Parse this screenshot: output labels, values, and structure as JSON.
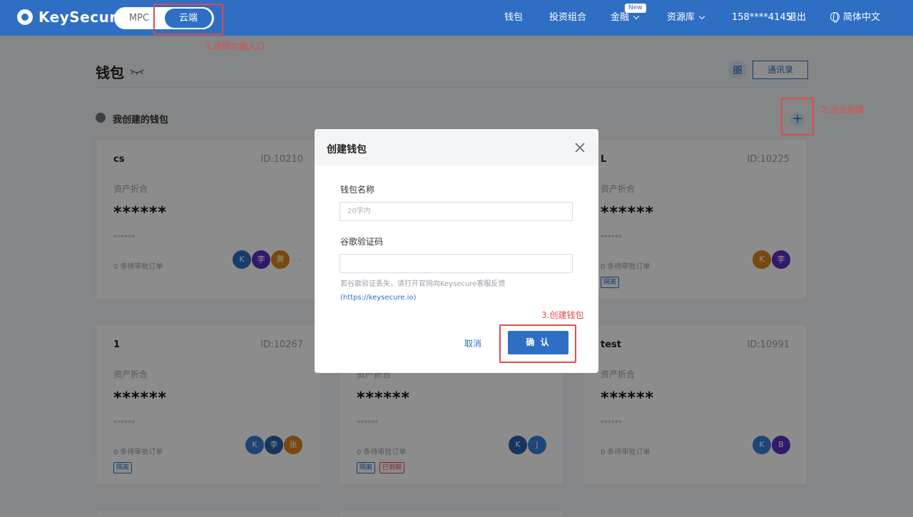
{
  "header": {
    "logo_text": "KeySecure",
    "mode_mpc": "MPC",
    "mode_cloud": "云端",
    "nav": {
      "wallet": "钱包",
      "portfolio": "投资组合",
      "finance": "金融",
      "finance_badge": "New",
      "resources": "资源库",
      "phone": "158****4145",
      "logout": "退出",
      "language": "简体中文"
    }
  },
  "page": {
    "title": "钱包",
    "contacts_button": "通讯录",
    "section_title": "我创建的钱包"
  },
  "cards": [
    {
      "name": "cs",
      "id": "ID:10210",
      "asset_label": "资产折合",
      "value": "******",
      "sub": "******",
      "pending": "0 条待审批订单",
      "tags": [],
      "avatars": [
        {
          "text": "K",
          "color": "#2e6fc4"
        },
        {
          "text": "李",
          "color": "#5b2fc4"
        },
        {
          "text": "黄",
          "color": "#d9861b"
        }
      ],
      "more": "· ·"
    },
    {
      "name": "L",
      "id": "ID:10225",
      "asset_label": "资产折合",
      "value": "******",
      "sub": "******",
      "pending": "0 条待审批订单",
      "tags": [
        {
          "text": "隔离",
          "color": "#2e6fc4"
        }
      ],
      "avatars": [
        {
          "text": "K",
          "color": "#d9861b"
        },
        {
          "text": "李",
          "color": "#5b2fc4"
        }
      ]
    },
    {
      "name": "1",
      "id": "ID:10267",
      "asset_label": "资产折合",
      "value": "******",
      "sub": "******",
      "pending": "0 条待审批订单",
      "tags": [
        {
          "text": "隔离",
          "color": "#2e6fc4"
        }
      ],
      "avatars": [
        {
          "text": "K",
          "color": "#3a7fd8"
        },
        {
          "text": "李",
          "color": "#2a5fa8"
        },
        {
          "text": "张",
          "color": "#d9861b"
        }
      ]
    },
    {
      "name": "",
      "id": "",
      "asset_label": "资产折合",
      "value": "******",
      "sub": "******",
      "pending": "0 条待审批订单",
      "tags": [
        {
          "text": "隔离",
          "color": "#2e6fc4"
        },
        {
          "text": "已到期",
          "color": "#e04a4a"
        }
      ],
      "avatars": [
        {
          "text": "K",
          "color": "#2a5fa8"
        },
        {
          "text": "J",
          "color": "#3a7fd8"
        }
      ]
    },
    {
      "name": "test",
      "id": "ID:10991",
      "asset_label": "资产折合",
      "value": "******",
      "sub": "******",
      "pending": "0 条待审批订单",
      "tags": [],
      "avatars": [
        {
          "text": "K",
          "color": "#3a7fd8"
        },
        {
          "text": "B",
          "color": "#5b2fc4"
        }
      ]
    }
  ],
  "modal": {
    "title": "创建钱包",
    "name_label": "钱包名称",
    "name_placeholder": "20字内",
    "name_value": "",
    "code_label": "谷歌验证码",
    "code_value": "",
    "hint": "若谷歌验证丢失，请打开官网向Keysecure客服反馈",
    "hint_link": "(https://keysecure.io)",
    "cancel": "取消",
    "confirm": "确 认"
  },
  "annotations": {
    "step1": "1.选择功能入口",
    "step2": "2.点击创建",
    "step3": "3.创建钱包"
  },
  "colors": {
    "brand": "#2e6fc4",
    "annotation": "#e04a4a"
  }
}
